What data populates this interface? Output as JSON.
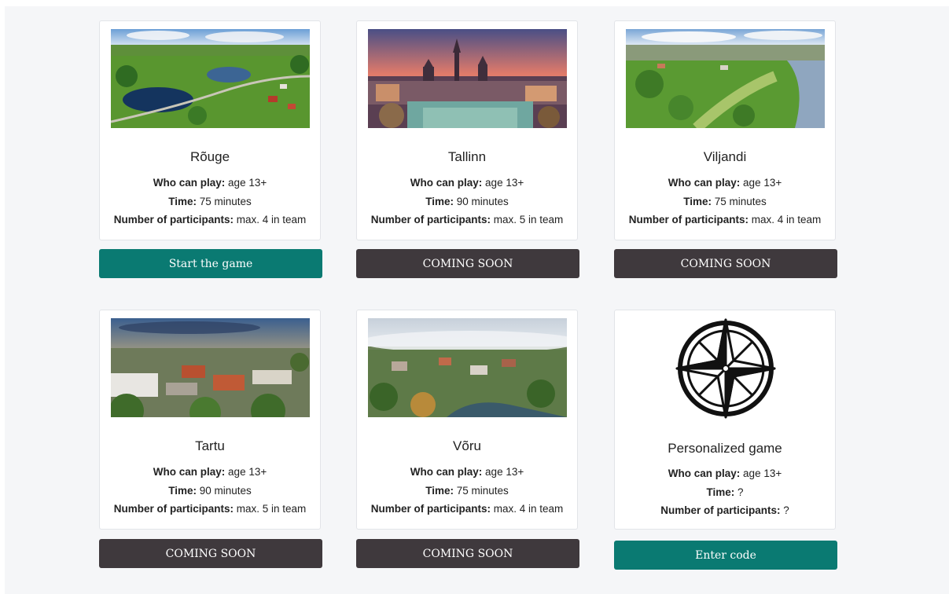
{
  "cards": [
    {
      "title": "Rõuge",
      "who_label": "Who can play:",
      "who_value": "age 13+",
      "time_label": "Time:",
      "time_value": "75 minutes",
      "participants_label": "Number of participants:",
      "participants_value": "max. 4 in team",
      "button": "Start the game",
      "image": "rouge-lakes-aerial-photo"
    },
    {
      "title": "Tallinn",
      "who_label": "Who can play:",
      "who_value": "age 13+",
      "time_label": "Time:",
      "time_value": "90 minutes",
      "participants_label": "Number of participants:",
      "participants_value": "max. 5 in team",
      "button": "COMING SOON",
      "image": "tallinn-old-town-sunset-photo"
    },
    {
      "title": "Viljandi",
      "who_label": "Who can play:",
      "who_value": "age 13+",
      "time_label": "Time:",
      "time_value": "75 minutes",
      "participants_label": "Number of participants:",
      "participants_value": "max. 4 in team",
      "button": "COMING SOON",
      "image": "viljandi-aerial-photo"
    },
    {
      "title": "Tartu",
      "who_label": "Who can play:",
      "who_value": "age 13+",
      "time_label": "Time:",
      "time_value": "90 minutes",
      "participants_label": "Number of participants:",
      "participants_value": "max. 5 in team",
      "button": "COMING SOON",
      "image": "tartu-aerial-photo"
    },
    {
      "title": "Võru",
      "who_label": "Who can play:",
      "who_value": "age 13+",
      "time_label": "Time:",
      "time_value": "75 minutes",
      "participants_label": "Number of participants:",
      "participants_value": "max. 4 in team",
      "button": "COMING SOON",
      "image": "voru-foggy-aerial-photo"
    },
    {
      "title": "Personalized game",
      "who_label": "Who can play:",
      "who_value": "age 13+",
      "time_label": "Time:",
      "time_value": "?",
      "participants_label": "Number of participants:",
      "participants_value": "?",
      "button": "Enter code",
      "image": "compass-rose-icon"
    }
  ],
  "colors": {
    "button_active": "#0a7a72",
    "button_coming_soon": "#3f393d",
    "page_background": "#f5f6f8"
  }
}
